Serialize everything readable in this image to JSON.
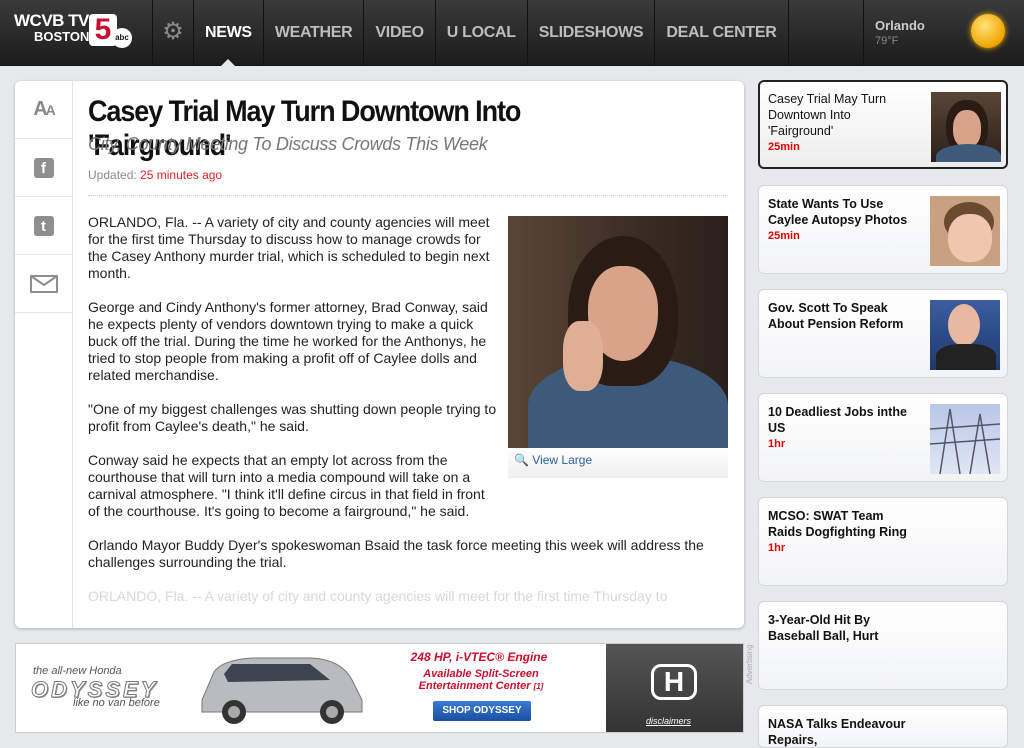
{
  "header": {
    "logo_line1": "WCVB TV",
    "logo_line2": "BOSTON",
    "logo_channel": "5",
    "logo_network": "abc",
    "nav": [
      "NEWS",
      "WEATHER",
      "VIDEO",
      "U LOCAL",
      "SLIDESHOWS",
      "DEAL CENTER"
    ],
    "active_nav": "NEWS",
    "weather": {
      "city": "Orlando",
      "temp": "79°F",
      "icon": "sun-icon"
    }
  },
  "article": {
    "headline": "Casey Trial May Turn Downtown Into 'Fairground'",
    "subhead": "City, County Meeting To Discuss Crowds This Week",
    "updated_label": "Updated:",
    "updated_value": "25 minutes ago",
    "view_large": "View Large",
    "paragraphs": [
      "ORLANDO, Fla. -- A variety of city and county agencies will meet for the first time Thursday to discuss how to manage crowds for the Casey Anthony murder trial, which is scheduled to begin next month.",
      "George and Cindy Anthony's former attorney, Brad Conway, said he expects plenty of vendors downtown trying to make a quick buck off the trial. During the time he worked for the Anthonys, he tried to stop people from making a profit off of Caylee dolls and related merchandise.",
      "\"One of my biggest challenges was shutting down people trying to profit from Caylee's death,\" he said.",
      "Conway said he expects that an empty lot across from the courthouse that will turn into a media compound will take on a carnival atmosphere. \"I think it'll define circus in that field in front of the courthouse. It's going to become a fairground,\" he said.",
      "Orlando Mayor Buddy Dyer's spokeswoman Bsaid the task force meeting this week will address the challenges surrounding the trial.",
      "ORLANDO, Fla. -- A variety of city and county agencies will meet for the first time Thursday to"
    ],
    "tools": [
      "text-size-icon",
      "facebook-icon",
      "twitter-icon",
      "email-icon"
    ]
  },
  "ad": {
    "line1": "the all-new Honda",
    "line2": "ODYSSEY",
    "line3": "like no van before",
    "headline": "248 HP, i-VTEC® Engine",
    "subline": "Available Split-Screen Entertainment Center",
    "footnote": "[1]",
    "cta": "SHOP ODYSSEY",
    "disclaimers": "disclaimers",
    "label": "Advertising"
  },
  "sidebar": [
    {
      "title": "Casey Trial May Turn Downtown Into 'Fairground'",
      "age": "25min",
      "active": true
    },
    {
      "title": "State Wants To Use Caylee Autopsy Photos",
      "age": "25min"
    },
    {
      "title": "Gov. Scott To Speak About Pension Reform",
      "age": ""
    },
    {
      "title": "10 Deadliest Jobs inthe US",
      "age": "1hr"
    },
    {
      "title": "MCSO: SWAT Team Raids Dogfighting Ring",
      "age": "1hr"
    },
    {
      "title": "3-Year-Old Hit By Baseball Ball, Hurt",
      "age": ""
    },
    {
      "title": "NASA Talks Endeavour Repairs,",
      "age": ""
    }
  ],
  "colors": {
    "accent_red": "#d22222",
    "link_blue": "#2a5d9f",
    "nav_bg": "#262626"
  }
}
